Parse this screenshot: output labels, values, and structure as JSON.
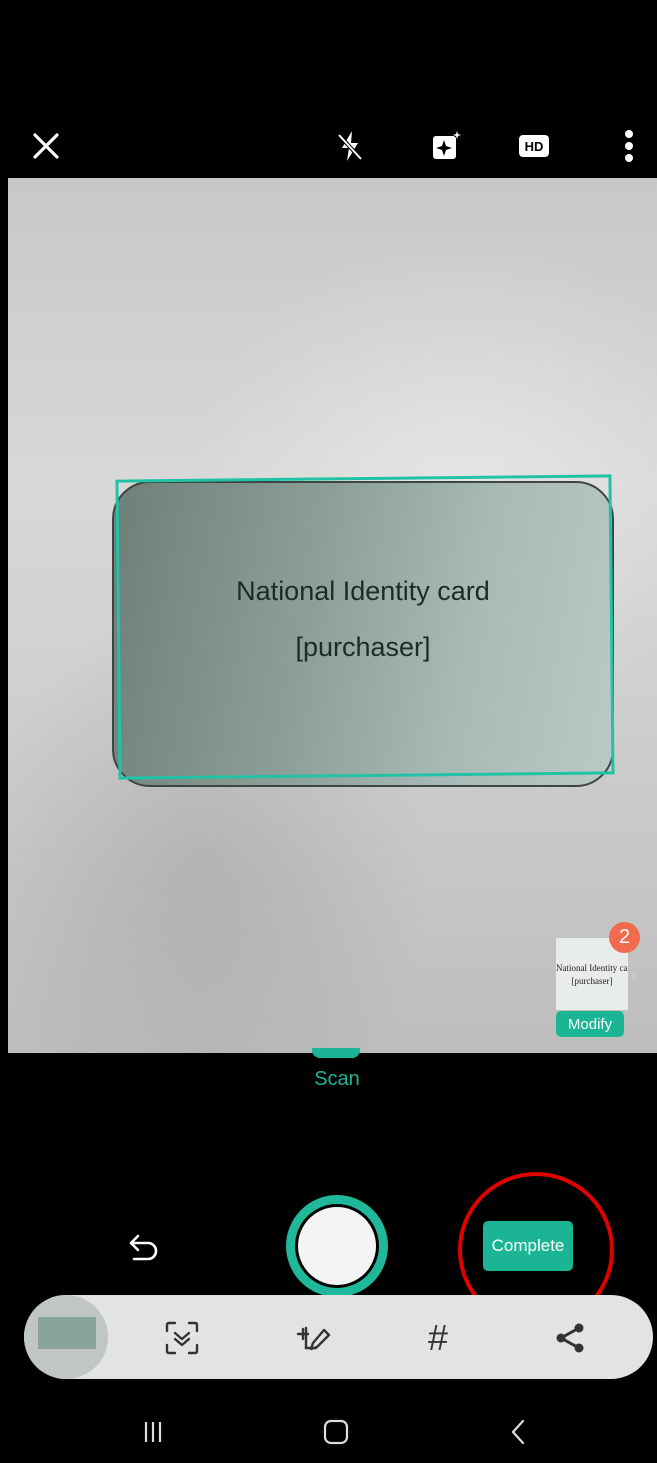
{
  "top_bar": {
    "icons": [
      "close-icon",
      "flash-off-icon",
      "auto-enhance-icon",
      "hd-icon",
      "more-icon"
    ],
    "hd_label": "HD"
  },
  "document": {
    "line1": "National Identity card",
    "line2": "[purchaser]"
  },
  "thumbnail": {
    "count": "2",
    "line1": "National Identity card",
    "line2": "[purchaser]",
    "modify_label": "Modify"
  },
  "mode": {
    "current": "Scan"
  },
  "controls": {
    "complete_label": "Complete"
  },
  "toolbar": {
    "icons": [
      "scan-qr-icon",
      "add-page-edit-icon",
      "hashtag-icon",
      "share-icon"
    ]
  },
  "nav": {
    "icons": [
      "recents-icon",
      "home-icon",
      "back-icon"
    ]
  },
  "colors": {
    "accent": "#1bb596",
    "badge": "#f06a4d",
    "annotation": "#e00000"
  }
}
